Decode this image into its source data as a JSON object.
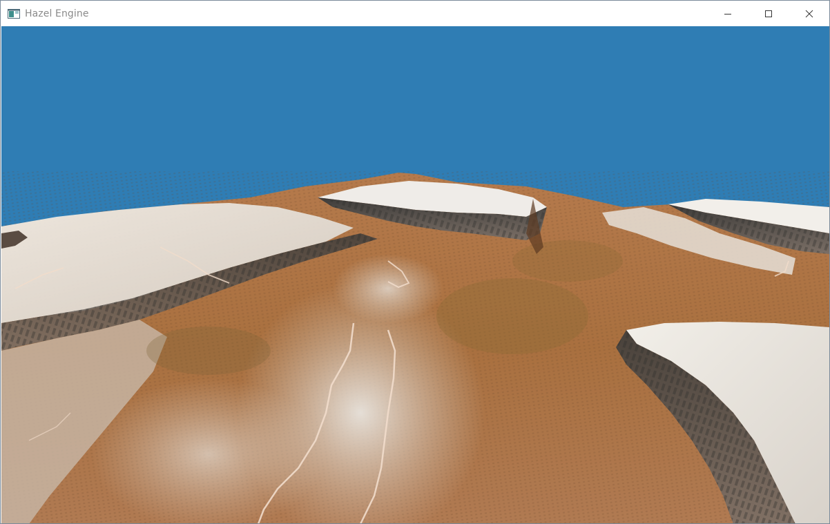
{
  "window": {
    "title": "Hazel Engine",
    "icons": {
      "app": "app-window-icon",
      "minimize": "minimize-icon",
      "maximize": "maximize-icon",
      "close": "close-icon"
    }
  },
  "scene": {
    "sky_color": "#2f7db4",
    "terrain_colors": {
      "snow": "#ece9e4",
      "rock_shadow": "#4c4a48",
      "earth": "#b06d3e",
      "moss": "#8a6a35"
    }
  }
}
